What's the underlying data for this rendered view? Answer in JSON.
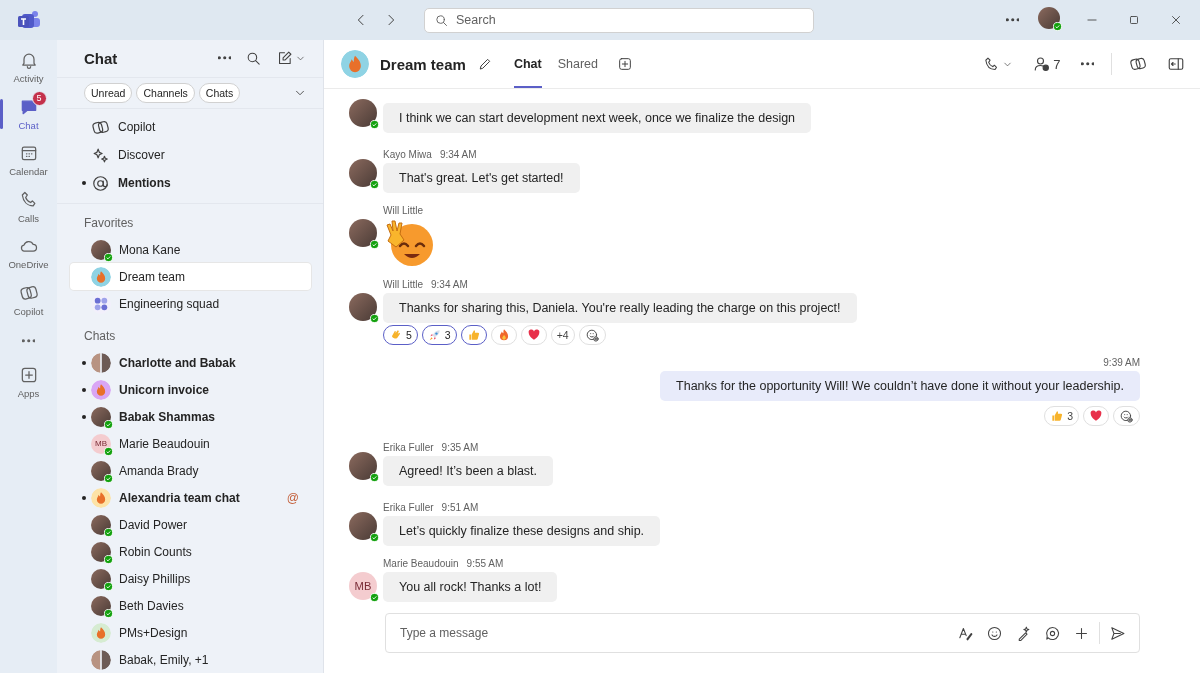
{
  "title_bar": {
    "search": {
      "placeholder": "Search"
    }
  },
  "rail": {
    "items": [
      {
        "kind": "activity",
        "label": "Activity",
        "selected": false
      },
      {
        "kind": "chat",
        "label": "Chat",
        "selected": true,
        "badge": "5"
      },
      {
        "kind": "calendar",
        "label": "Calendar",
        "selected": false
      },
      {
        "kind": "calls",
        "label": "Calls",
        "selected": false
      },
      {
        "kind": "onedrive",
        "label": "OneDrive",
        "selected": false
      },
      {
        "kind": "copilot",
        "label": "Copilot",
        "selected": false
      }
    ],
    "apps": {
      "label": "Apps"
    }
  },
  "chat_list": {
    "title": "Chat",
    "filters": [
      {
        "label": "Unread",
        "selected": false
      },
      {
        "label": "Channels",
        "selected": false
      },
      {
        "label": "Chats",
        "selected": false
      }
    ],
    "pinned": [
      {
        "kind": "copilot",
        "label": "Copilot",
        "unread": false
      },
      {
        "kind": "discover",
        "label": "Discover",
        "unread": false
      },
      {
        "kind": "mentions",
        "label": "Mentions",
        "unread": true
      }
    ],
    "favorites_heading": "Favorites",
    "favorites": [
      {
        "name": "Mona Kane",
        "avatar": {
          "kind": "photo"
        },
        "online": true,
        "selected": false,
        "unread": false
      },
      {
        "name": "Dream team",
        "avatar": {
          "kind": "emblem",
          "color": "#8fd3e4"
        },
        "online": false,
        "selected": true,
        "unread": false
      },
      {
        "name": "Engineering squad",
        "avatar": {
          "kind": "grid"
        },
        "online": false,
        "selected": false,
        "unread": false
      }
    ],
    "chats_heading": "Chats",
    "chats": [
      {
        "name": "Charlotte and Babak",
        "avatar": {
          "kind": "pair"
        },
        "online": false,
        "selected": false,
        "unread": true
      },
      {
        "name": "Unicorn invoice",
        "avatar": {
          "kind": "emblem",
          "color": "#d9a6f5"
        },
        "online": false,
        "selected": false,
        "unread": true
      },
      {
        "name": "Babak Shammas",
        "avatar": {
          "kind": "photo"
        },
        "online": true,
        "selected": false,
        "unread": true
      },
      {
        "name": "Marie Beaudouin",
        "avatar": {
          "kind": "initials",
          "text": "MB"
        },
        "online": true,
        "selected": false,
        "unread": false
      },
      {
        "name": "Amanda Brady",
        "avatar": {
          "kind": "photo"
        },
        "online": true,
        "selected": false,
        "unread": false
      },
      {
        "name": "Alexandria team chat",
        "avatar": {
          "kind": "emblem",
          "color": "#fde3a7"
        },
        "online": false,
        "selected": false,
        "unread": true,
        "mention": "@"
      },
      {
        "name": "David Power",
        "avatar": {
          "kind": "photo"
        },
        "online": true,
        "selected": false,
        "unread": false
      },
      {
        "name": "Robin Counts",
        "avatar": {
          "kind": "photo"
        },
        "online": true,
        "selected": false,
        "unread": false
      },
      {
        "name": "Daisy Phillips",
        "avatar": {
          "kind": "photo"
        },
        "online": true,
        "selected": false,
        "unread": false
      },
      {
        "name": "Beth Davies",
        "avatar": {
          "kind": "photo"
        },
        "online": true,
        "selected": false,
        "unread": false
      },
      {
        "name": "PMs+Design",
        "avatar": {
          "kind": "emblem",
          "color": "#d6ecd2"
        },
        "online": false,
        "selected": false,
        "unread": false
      },
      {
        "name": "Babak, Emily, +1",
        "avatar": {
          "kind": "pair"
        },
        "online": false,
        "selected": false,
        "unread": false
      }
    ]
  },
  "conversation": {
    "title": "Dream team",
    "tabs": [
      {
        "label": "Chat",
        "selected": true
      },
      {
        "label": "Shared",
        "selected": false
      }
    ],
    "participant_count": "7",
    "messages": [
      {
        "kind": "incoming",
        "avatar": {
          "kind": "photo"
        },
        "online": true,
        "text": "I think we can start development next week, once we finalize the design"
      },
      {
        "kind": "incoming",
        "author": "Kayo Miwa",
        "time": "9:34 AM",
        "avatar": {
          "kind": "photo"
        },
        "online": true,
        "text": "That's great. Let's get started!"
      },
      {
        "kind": "sticker",
        "author": "Will Little",
        "avatar": {
          "kind": "photo"
        },
        "online": true
      },
      {
        "kind": "incoming",
        "author": "Will Little",
        "time": "9:34 AM",
        "avatar": {
          "kind": "photo"
        },
        "online": true,
        "text": "Thanks for sharing this, Daniela. You're really leading the charge on this project!",
        "reactions": [
          {
            "kind": "clap",
            "count": "5",
            "selected": true
          },
          {
            "kind": "rocket",
            "count": "3",
            "selected": true
          },
          {
            "kind": "thumbs",
            "selected": true
          },
          {
            "kind": "fire",
            "selected": false
          },
          {
            "kind": "heart",
            "selected": false
          },
          {
            "kind": "more",
            "count": "+4",
            "selected": false
          }
        ]
      },
      {
        "kind": "outgoing",
        "time": "9:39 AM",
        "text": "Thanks for the opportunity Will! We couldn’t have done it without your leadership.",
        "reactions": [
          {
            "kind": "thumbs",
            "count": "3",
            "selected": false
          },
          {
            "kind": "heart",
            "selected": false
          }
        ]
      },
      {
        "kind": "incoming",
        "author": "Erika Fuller",
        "time": "9:35 AM",
        "avatar": {
          "kind": "photo"
        },
        "online": true,
        "text": "Agreed! It’s been a blast."
      },
      {
        "kind": "incoming",
        "author": "Erika Fuller",
        "time": "9:51 AM",
        "avatar": {
          "kind": "photo"
        },
        "online": true,
        "text": "Let’s quickly finalize these designs and ship."
      },
      {
        "kind": "incoming",
        "author": "Marie Beaudouin",
        "time": "9:55 AM",
        "avatar": {
          "kind": "initials",
          "text": "MB"
        },
        "online": true,
        "text": "You all rock! Thanks a lot!"
      }
    ],
    "composer": {
      "placeholder": "Type a message"
    }
  }
}
